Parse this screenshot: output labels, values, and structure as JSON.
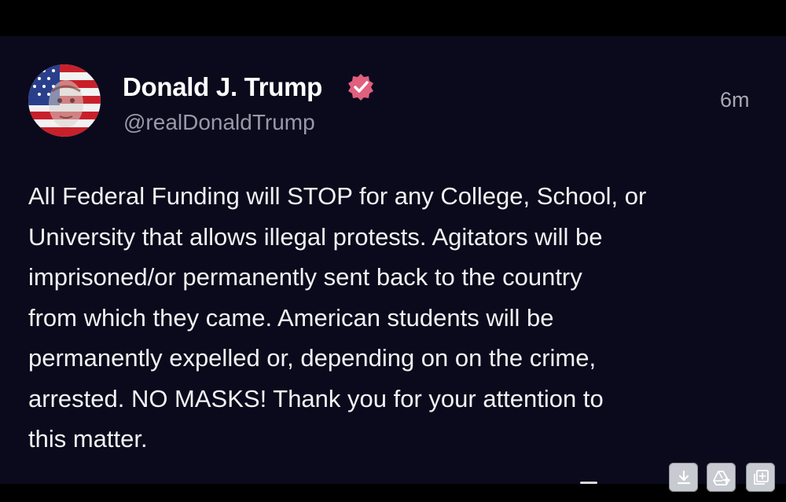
{
  "post": {
    "author_name": "Donald J. Trump",
    "author_handle": "@realDonaldTrump",
    "timestamp": "6m",
    "body_lines": [
      "All Federal Funding will STOP for any College, School, or",
      "University that allows illegal protests. Agitators will be",
      "imprisoned/or permanently sent back to the country",
      "from which they came. American students will be",
      "permanently expelled or, depending on on the crime,",
      "arrested. NO MASKS! Thank you for your attention to",
      "this matter."
    ],
    "avatar_icon": "flag-portrait-avatar",
    "verified_icon": "verified-badge-icon"
  },
  "toolbar": {
    "buttons": [
      "download-icon",
      "drive-add-icon",
      "add-to-collection-icon"
    ]
  },
  "colors": {
    "post_background": "#0b0a1c",
    "verified_badge": "#e0607e",
    "frame": "#000000"
  }
}
